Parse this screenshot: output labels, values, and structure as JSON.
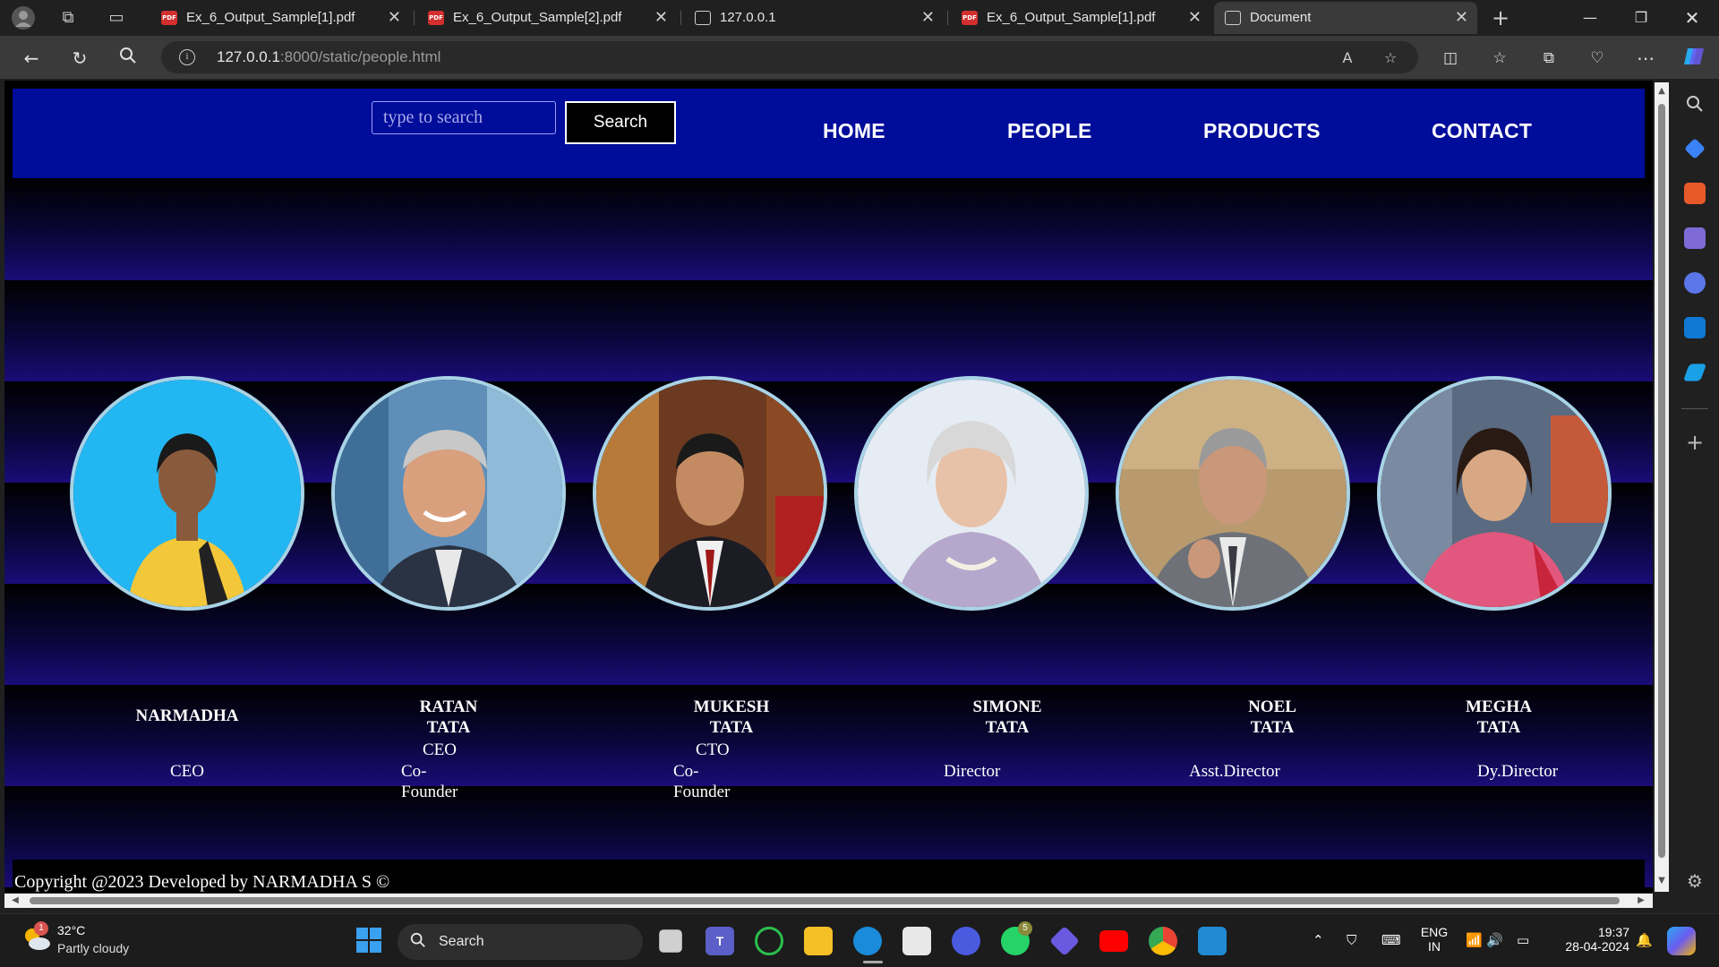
{
  "browser": {
    "tabs": [
      {
        "title": "Ex_6_Output_Sample[1].pdf",
        "icon": "pdf-icon"
      },
      {
        "title": "Ex_6_Output_Sample[2].pdf",
        "icon": "pdf-icon"
      },
      {
        "title": "127.0.0.1",
        "icon": "page-icon"
      },
      {
        "title": "Ex_6_Output_Sample[1].pdf",
        "icon": "pdf-icon"
      },
      {
        "title": "Document",
        "icon": "document-icon"
      }
    ],
    "url_host": "127.0.0.1",
    "url_path": ":8000/static/people.html"
  },
  "site": {
    "search_placeholder": "type to search",
    "search_button": "Search",
    "nav": [
      "HOME",
      "PEOPLE",
      "PRODUCTS",
      "CONTACT"
    ],
    "people": [
      {
        "name_lines": [
          "NARMADHA"
        ],
        "role_lines": [
          "CEO"
        ],
        "photo": "woman-yellow-top-blue-background"
      },
      {
        "name_lines": [
          "RATAN",
          "TATA"
        ],
        "role_top": "CEO",
        "role_lines": [
          "Co-",
          "Founder"
        ],
        "photo": "elderly-man-smiling-city-background"
      },
      {
        "name_lines": [
          "MUKESH",
          "TATA"
        ],
        "role_top": "CTO",
        "role_lines": [
          "Co-",
          "Founder"
        ],
        "photo": "man-suit-library-background"
      },
      {
        "name_lines": [
          "SIMONE",
          "TATA"
        ],
        "role_lines": [
          "Director"
        ],
        "photo": "elderly-woman-white-hair"
      },
      {
        "name_lines": [
          "NOEL",
          "TATA"
        ],
        "role_lines": [
          "Asst.Director"
        ],
        "photo": "man-grey-suit-thinking"
      },
      {
        "name_lines": [
          "MEGHA",
          "TATA"
        ],
        "role_lines": [
          "Dy.Director"
        ],
        "photo": "woman-pink-dress"
      }
    ],
    "footer": "Copyright @2023 Developed by NARMADHA S ©"
  },
  "taskbar": {
    "weather_temp": "32°C",
    "weather_desc": "Partly cloudy",
    "weather_badge": "1",
    "search_label": "Search",
    "whatsapp_badge": "5",
    "lang_top": "ENG",
    "lang_bottom": "IN",
    "time": "19:37",
    "date": "28-04-2024"
  },
  "colors": {
    "header_bg": "#000c9a",
    "band_dark": "#000000",
    "band_light": "#1a0c78",
    "photo_border": "#a9d3e6"
  }
}
